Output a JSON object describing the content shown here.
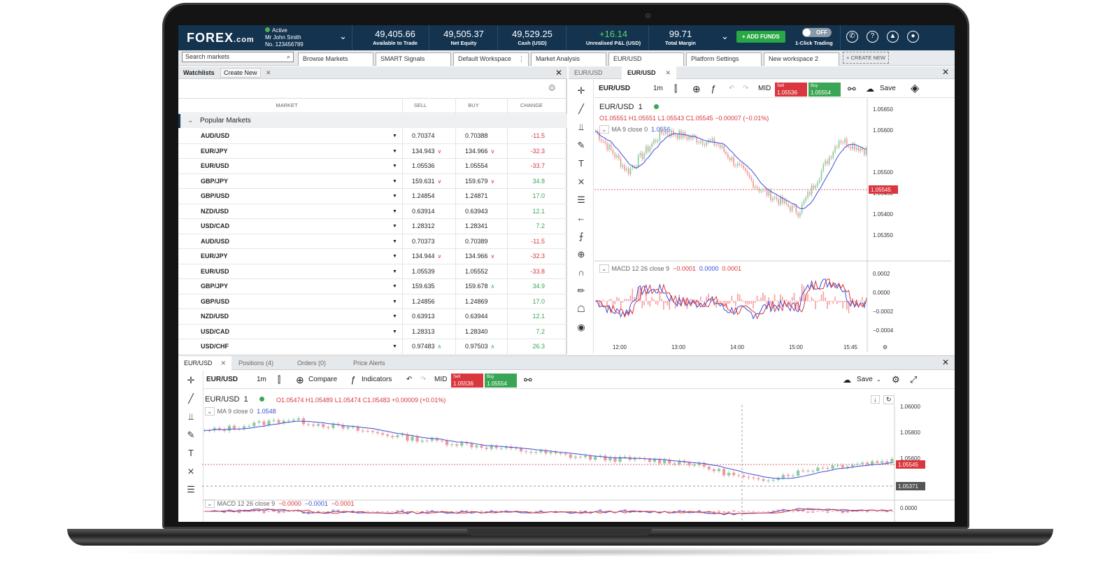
{
  "brand": {
    "logo": "FOREX",
    "logo_suffix": ".com"
  },
  "account": {
    "status": "Active",
    "name": "Mr John Smith",
    "number": "No. 123456789"
  },
  "stats": [
    {
      "value": "49,405.66",
      "label": "Available to Trade"
    },
    {
      "value": "49,505.37",
      "label": "Net Equity"
    },
    {
      "value": "49,529.25",
      "label": "Cash (USD)"
    },
    {
      "value": "+16.14",
      "label": "Unrealised P&L (USD)"
    },
    {
      "value": "99.71",
      "label": "Total Margin"
    }
  ],
  "header": {
    "add_funds": "+ ADD FUNDS",
    "toggle": "OFF",
    "one_click": "1-Click Trading",
    "icons": [
      "phone-icon",
      "help-icon",
      "bell-icon",
      "user-icon"
    ]
  },
  "search": {
    "placeholder": "Search markets"
  },
  "workspace_tabs": [
    "Browse Markets",
    "SMART Signals",
    "Default Workspace",
    "Market Analysis",
    "EUR/USD",
    "Platform Settings",
    "New workspace 2"
  ],
  "create_new": "+ CREATE NEW",
  "watchlist": {
    "title": "Watchlists",
    "create": "Create New",
    "columns": [
      "MARKET",
      "SELL",
      "BUY",
      "CHANGE"
    ],
    "group": "Popular Markets",
    "rows": [
      {
        "market": "AUD/USD",
        "sell": "0.70374",
        "buy": "0.70388",
        "change": "-11.5",
        "dir": "neg",
        "sa": "",
        "ba": ""
      },
      {
        "market": "EUR/JPY",
        "sell": "134.943",
        "buy": "134.966",
        "change": "-32.3",
        "dir": "neg",
        "sa": "down",
        "ba": "down"
      },
      {
        "market": "EUR/USD",
        "sell": "1.05536",
        "buy": "1.05554",
        "change": "-33.7",
        "dir": "neg",
        "sa": "",
        "ba": ""
      },
      {
        "market": "GBP/JPY",
        "sell": "159.631",
        "buy": "159.679",
        "change": "34.8",
        "dir": "pos",
        "sa": "down",
        "ba": "down"
      },
      {
        "market": "GBP/USD",
        "sell": "1.24854",
        "buy": "1.24871",
        "change": "17.0",
        "dir": "pos",
        "sa": "",
        "ba": ""
      },
      {
        "market": "NZD/USD",
        "sell": "0.63914",
        "buy": "0.63943",
        "change": "12.1",
        "dir": "pos",
        "sa": "",
        "ba": ""
      },
      {
        "market": "USD/CAD",
        "sell": "1.28312",
        "buy": "1.28341",
        "change": "7.2",
        "dir": "pos",
        "sa": "",
        "ba": ""
      },
      {
        "market": "AUD/USD",
        "sell": "0.70373",
        "buy": "0.70389",
        "change": "-11.5",
        "dir": "neg",
        "sa": "",
        "ba": ""
      },
      {
        "market": "EUR/JPY",
        "sell": "134.944",
        "buy": "134.966",
        "change": "-32.3",
        "dir": "neg",
        "sa": "down",
        "ba": "down"
      },
      {
        "market": "EUR/USD",
        "sell": "1.05539",
        "buy": "1.05552",
        "change": "-33.8",
        "dir": "neg",
        "sa": "",
        "ba": ""
      },
      {
        "market": "GBP/JPY",
        "sell": "159.635",
        "buy": "159.678",
        "change": "34.9",
        "dir": "pos",
        "sa": "",
        "ba": "up"
      },
      {
        "market": "GBP/USD",
        "sell": "1.24856",
        "buy": "1.24869",
        "change": "17.0",
        "dir": "pos",
        "sa": "",
        "ba": ""
      },
      {
        "market": "NZD/USD",
        "sell": "0.63913",
        "buy": "0.63944",
        "change": "12.1",
        "dir": "pos",
        "sa": "",
        "ba": ""
      },
      {
        "market": "USD/CAD",
        "sell": "1.28313",
        "buy": "1.28340",
        "change": "7.2",
        "dir": "pos",
        "sa": "",
        "ba": ""
      },
      {
        "market": "USD/CHF",
        "sell": "0.97483",
        "buy": "0.97503",
        "change": "26.3",
        "dir": "pos",
        "sa": "up",
        "ba": "up"
      }
    ]
  },
  "right_chart": {
    "tabs": [
      "EUR/USD",
      "EUR/USD"
    ],
    "symbol": "EUR/USD",
    "interval": "1m",
    "mid": "MID",
    "sell_label": "Sell",
    "sell": "1.05536",
    "buy_label": "Buy",
    "buy": "1.05554",
    "save": "Save",
    "legend_symbol": "EUR/USD",
    "legend_interval": "1",
    "ohlc": "O1.05551  H1.05551  L1.05543  C1.05545  −0.00007 (−0.01%)",
    "ma": "MA 9 close 0",
    "ma_value": "1.0556",
    "macd": "MACD 12 26 close 9",
    "macd_v1": "−0.0001",
    "macd_v2": "0.0000",
    "macd_v3": "0.0001",
    "price_axis": [
      "1.05650",
      "1.05600",
      "1.05500",
      "1.05450",
      "1.05400",
      "1.05350"
    ],
    "current_price": "1.05545",
    "macd_axis": [
      "0.0002",
      "0.0000",
      "−0.0002",
      "−0.0004"
    ],
    "time_axis": [
      "12:00",
      "13:00",
      "14:00",
      "15:00",
      "15:45"
    ]
  },
  "bottom_tabs": [
    "EUR/USD",
    "Positions (4)",
    "Orders (0)",
    "Price Alerts"
  ],
  "bottom_chart": {
    "symbol": "EUR/USD",
    "interval": "1m",
    "compare": "Compare",
    "indicators": "Indicators",
    "mid": "MID",
    "sell_label": "Sell",
    "sell": "1.05536",
    "buy_label": "Buy",
    "buy": "1.05554",
    "save": "Save",
    "legend_symbol": "EUR/USD",
    "legend_interval": "1",
    "ohlc": "O1.05474  H1.05489  L1.05474  C1.05483  +0.00009 (+0.01%)",
    "ma": "MA 9 close 0",
    "ma_value": "1.0548",
    "macd": "MACD 12 26 close 9",
    "macd_v1": "−0.0000",
    "macd_v2": "−0.0001",
    "macd_v3": "−0.0001",
    "price_axis": [
      "1.06000",
      "1.05800",
      "1.05600"
    ],
    "current_price": "1.05545",
    "crosshair_price": "1.05371",
    "macd_axis": "0.0000"
  },
  "colors": {
    "header": "#13334f",
    "sell": "#d9363e",
    "buy": "#3aa655",
    "ma": "#3a4fd9"
  }
}
